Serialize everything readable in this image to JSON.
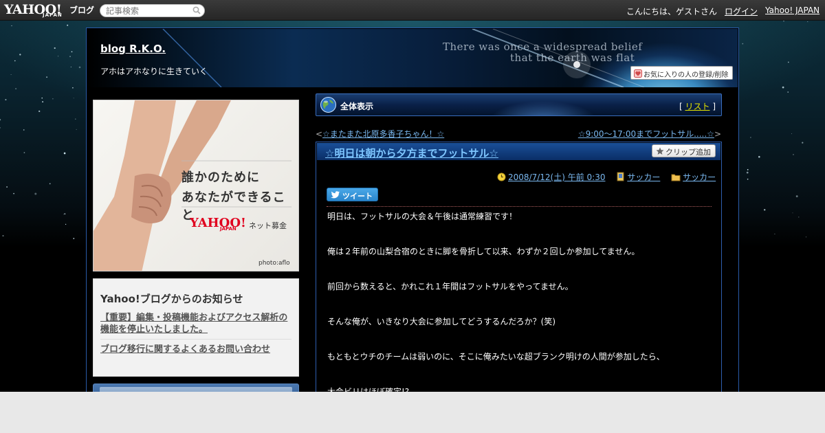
{
  "topbar": {
    "logo_text": "YAHOO!",
    "logo_sub": "JAPAN",
    "logo_blog": "ブログ",
    "search_placeholder": "記事検索",
    "greeting": "こんにちは、ゲストさん",
    "login": "ログイン",
    "yahoo_japan": "Yahoo! JAPAN"
  },
  "header": {
    "blog_title": "blog R.K.O.",
    "blog_subtitle": "アホはアホなりに生きていく",
    "banner_line1": "There was once a widespread belief",
    "banner_line2": "that the earth was flat",
    "favorite_button": "お気に入りの人の登録/削除"
  },
  "ad": {
    "line1": "誰かのために",
    "line2": "あなたができること",
    "brand": "YAHOO!",
    "brand_sub": "JAPAN",
    "service": "ネット募金",
    "credit": "photo:aflo"
  },
  "notice": {
    "title": "Yahoo!ブログからのお知らせ",
    "links": [
      "【重要】編集・投稿機能およびアクセス解析の機能を停止いたしました。",
      "ブログ移行に関するよくあるお問い合わせ"
    ]
  },
  "category_bar": {
    "label": "全体表示",
    "list_open": "[",
    "list_link": "リスト",
    "list_close": "]"
  },
  "nav": {
    "prev_arrow": "<",
    "prev_title": "☆またまた北原多香子ちゃん！☆",
    "next_title": "☆9:00～17:00までフットサル.....☆",
    "next_arrow": ">"
  },
  "entry": {
    "title": "☆明日は朝から夕方までフットサル☆",
    "clip_button": "クリップ追加",
    "date": "2008/7/12(土) 午前 0:30",
    "tag": "サッカー",
    "category": "サッカー",
    "tweet_button": "ツイート",
    "paragraphs": [
      "明日は、フットサルの大会＆午後は通常練習です！",
      "俺は２年前の山梨合宿のときに脚を骨折して以来、わずか２回しか参加してません。",
      "前回から数えると、かれこれ１年間はフットサルをやってません。",
      "そんな俺が、いきなり大会に参加してどうするんだろか？(笑)",
      "もともとウチのチームは弱いのに、そこに俺みたいな超ブランク明けの人間が参加したら、",
      "大会ビリはほぼ確定!?"
    ]
  },
  "colors": {
    "accent_link": "#7ab8f0",
    "border_blue": "#2f5fb0",
    "list_link": "#e6e600"
  }
}
